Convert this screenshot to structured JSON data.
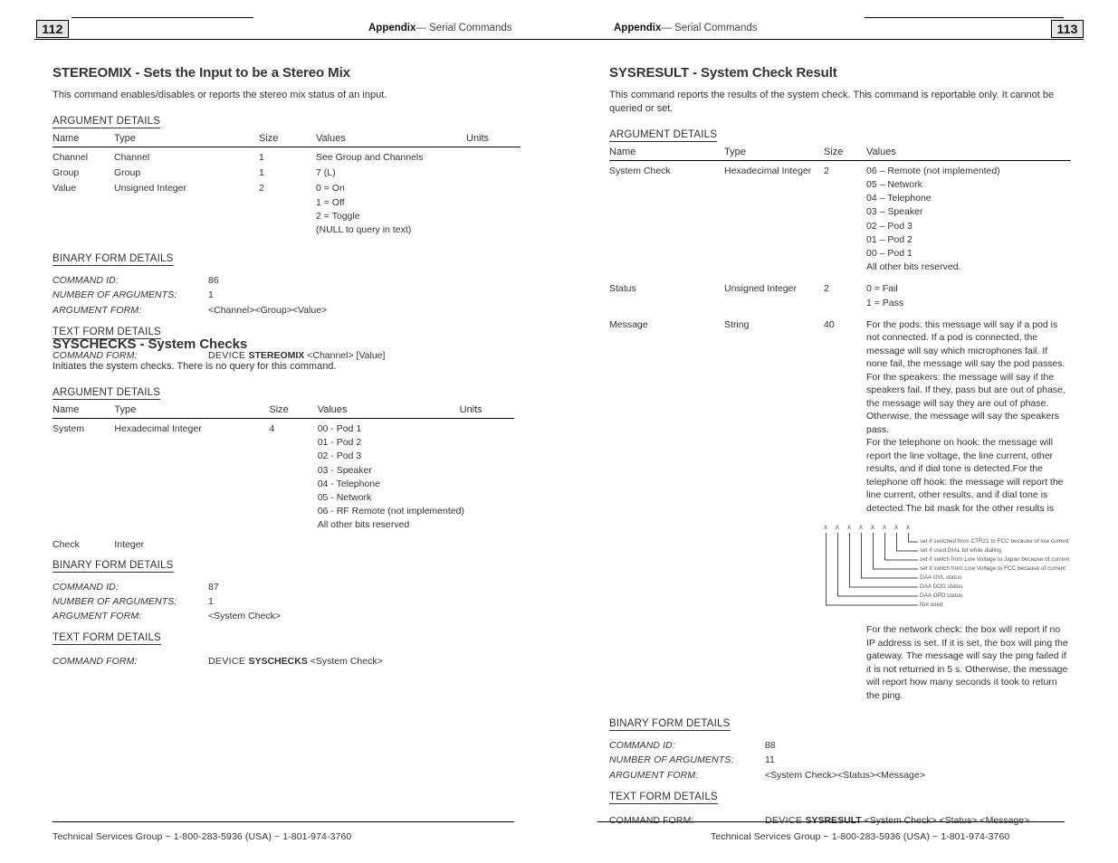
{
  "document": {
    "footer_text": "Technical Services Group ~ 1-800-283-5936 (USA) ~ 1-801-974-3760"
  },
  "left_page": {
    "page_number": "112",
    "header_bold": "Appendix",
    "header_rest": "—  Serial Commands",
    "sections": [
      {
        "title": "STEREOMIX - Sets the Input to be a Stereo Mix",
        "description": "This command enables/disables or reports the stereo mix status of an input.",
        "argument_details_label": "ARGUMENT DETAILS",
        "table": {
          "headers": [
            "Name",
            "Type",
            "Size",
            "Values",
            "Units"
          ],
          "rows": [
            {
              "name": "Channel",
              "type": "Channel",
              "size": "1",
              "values": [
                "See Group and Channels"
              ],
              "units": ""
            },
            {
              "name": "Group",
              "type": "Group",
              "size": "1",
              "values": [
                "7 (L)"
              ],
              "units": ""
            },
            {
              "name": "Value",
              "type": "Unsigned Integer",
              "size": "2",
              "values": [
                "0 = On",
                "1 = Off",
                "2 = Toggle",
                "(NULL to query in text)"
              ],
              "units": ""
            }
          ]
        },
        "binary_form_label": "BINARY FORM DETAILS",
        "binary_form": [
          {
            "key": "COMMAND ID:",
            "value": "86"
          },
          {
            "key": "NUMBER OF ARGUMENTS:",
            "value": "1"
          },
          {
            "key": "ARGUMENT FORM:",
            "value": "<Channel><Group><Value>"
          }
        ],
        "text_form_label": "TEXT FORM DETAILS",
        "text_form": {
          "key": "COMMAND FORM:",
          "prefix": "DEVICE ",
          "command": "STEREOMIX",
          "suffix": " <Channel> [Value]"
        }
      },
      {
        "title": "SYSCHECKS - System Checks",
        "description": "Initiates the system checks. There is no query for this command.",
        "argument_details_label": "ARGUMENT DETAILS",
        "table": {
          "headers": [
            "Name",
            "Type",
            "Size",
            "Values",
            "Units"
          ],
          "rows": [
            {
              "name": "System",
              "type": "Hexadecimal Integer",
              "size": "4",
              "values": [
                "00 - Pod 1",
                "01 - Pod 2",
                "02 - Pod 3",
                "03 - Speaker",
                "04 - Telephone",
                "05 - Network",
                "06 - RF Remote (not implemented)",
                "All other bits reserved"
              ],
              "units": ""
            },
            {
              "name": "Check",
              "type": "Integer",
              "size": "",
              "values": [],
              "units": ""
            }
          ]
        },
        "binary_form_label": "BINARY FORM DETAILS",
        "binary_form": [
          {
            "key": "COMMAND ID:",
            "value": "87"
          },
          {
            "key": "NUMBER OF ARGUMENTS:",
            "value": "1"
          },
          {
            "key": "ARGUMENT FORM:",
            "value": "<System Check>"
          }
        ],
        "text_form_label": "TEXT FORM DETAILS",
        "text_form": {
          "key": "COMMAND FORM:",
          "prefix": "DEVICE ",
          "command": "SYSCHECKS",
          "suffix": " <System Check>"
        }
      }
    ]
  },
  "right_page": {
    "page_number": "113",
    "header_bold": "Appendix",
    "header_rest": "—  Serial Commands",
    "section": {
      "title": "SYSRESULT - System Check Result",
      "description": "This command reports the results of the system check. This command is reportable only. It cannot be queried or set.",
      "argument_details_label": "ARGUMENT DETAILS",
      "table": {
        "headers": [
          "Name",
          "Type",
          "Size",
          "Values"
        ],
        "rows": [
          {
            "name": "System Check",
            "type": "Hexadecimal Integer",
            "size": "2",
            "values": [
              "06 – Remote (not implemented)",
              "05 – Network",
              "04 – Telephone",
              "03 – Speaker",
              "02 – Pod 3",
              "01 – Pod 2",
              "00 – Pod 1",
              "All other bits reserved."
            ]
          },
          {
            "name": "Status",
            "type": "Unsigned Integer",
            "size": "2",
            "values": [
              "0 = Fail",
              "1 = Pass"
            ]
          },
          {
            "name": "Message",
            "type": "String",
            "size": "40",
            "paragraphs": [
              "For the pods: this message will say if a pod is not connected. If a pod is connected, the message will say which microphones fail. If none fail, the message will say the pod passes. For the speakers: the message will say if the speakers fail. If they, pass but are out of phase, the message will say they are out of phase. Otherwise, the message will say the speakers pass.",
              "For the telephone on hook: the message will report the line voltage, the line current, other results, and if dial tone is detected.For the telephone off hook: the message will report the line current, other results, and if dial tone is detected.The bit mask for the other results is"
            ],
            "paragraph_after": "For the network check: the box will report if no IP address is set. If it is set, the box will ping the gateway. The message will say the ping failed if it is not returned in 5 s. Otherwise, the message will report how many seconds it took to return the ping."
          }
        ]
      },
      "bitmask": {
        "bits": [
          "x",
          "x",
          "x",
          "x",
          "x",
          "x",
          "x",
          "x"
        ],
        "labels": [
          "set if switched from CTR21 to FCC because of low current",
          "set if used DIAL bit while dialing",
          "set if switch from Low Voltage to Japan because of current",
          "set if switch from Low Voltage to FCC because of current",
          "DAA OVL status",
          "DAA DOD status",
          "DAA OPD status",
          "Not used"
        ]
      },
      "binary_form_label": "BINARY FORM DETAILS",
      "binary_form": [
        {
          "key": "COMMAND ID:",
          "value": "88"
        },
        {
          "key": "NUMBER OF ARGUMENTS:",
          "value": "11"
        },
        {
          "key": "ARGUMENT FORM:",
          "value": "<System Check><Status><Message>"
        }
      ],
      "text_form_label": "TEXT FORM DETAILS",
      "text_form": {
        "key": "COMMAND FORM:",
        "prefix": "DEVICE ",
        "command": "SYSRESULT",
        "suffix": " <System Check> <Status> <Message>"
      }
    }
  }
}
